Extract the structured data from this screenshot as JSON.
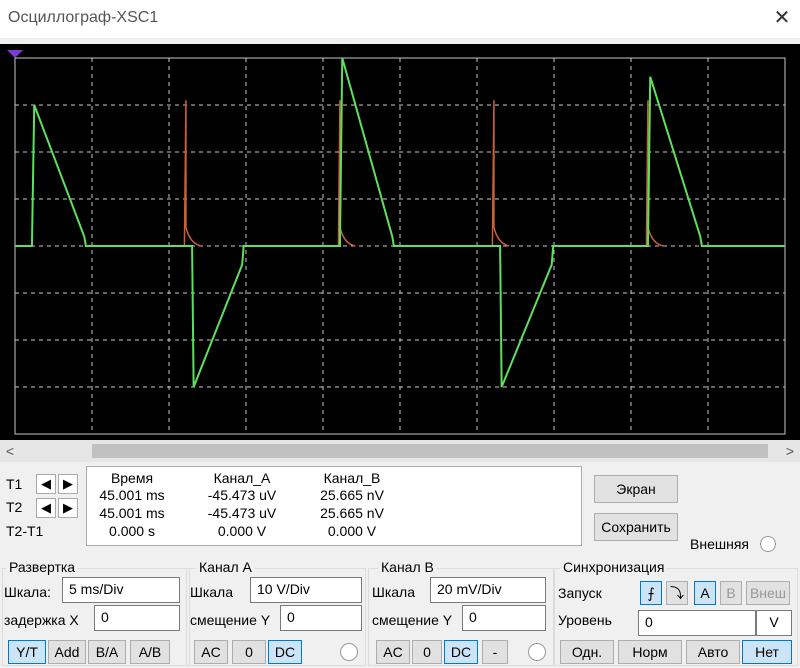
{
  "window": {
    "title": "Осциллограф-XSC1",
    "close": "✕"
  },
  "scrollbar": {
    "left": "<",
    "right": ">"
  },
  "cursors": {
    "t1_label": "T1",
    "t2_label": "T2",
    "dt_label": "T2-T1",
    "left_arrow": "◀",
    "right_arrow": "▶",
    "headers": {
      "time": "Время",
      "a": "Канал_A",
      "b": "Канал_B"
    },
    "rows": [
      {
        "time": "45.001 ms",
        "a": "-45.473 uV",
        "b": "25.665 nV"
      },
      {
        "time": "45.001 ms",
        "a": "-45.473 uV",
        "b": "25.665 nV"
      },
      {
        "time": "0.000 s",
        "a": "0.000 V",
        "b": "0.000 V"
      }
    ]
  },
  "buttons": {
    "screen": "Экран",
    "save": "Сохранить",
    "external": "Внешняя"
  },
  "timebase": {
    "title": "Развертка",
    "scale_label": "Шкала:",
    "scale_value": "5 ms/Div",
    "delay_label": "задержка X",
    "delay_value": "0",
    "modes": [
      "Y/T",
      "Add",
      "B/A",
      "A/B"
    ]
  },
  "channel_a": {
    "title": "Канал A",
    "scale_label": "Шкала",
    "scale_value": "10  V/Div",
    "offset_label": "смещение Y",
    "offset_value": "0",
    "coupling": [
      "AC",
      "0",
      "DC"
    ]
  },
  "channel_b": {
    "title": "Канал B",
    "scale_label": "Шкала",
    "scale_value": "20 mV/Div",
    "offset_label": "смещение Y",
    "offset_value": "0",
    "coupling": [
      "AC",
      "0",
      "DC",
      "-"
    ]
  },
  "trigger": {
    "title": "Синхронизация",
    "edge_label": "Запуск",
    "edge_rise": "⨍",
    "edge_fall": "⤵",
    "sources": [
      "A",
      "B",
      "Внеш"
    ],
    "level_label": "Уровень",
    "level_value": "0",
    "level_unit": "V",
    "modes": [
      "Одн.",
      "Норм",
      "Авто",
      "Нет"
    ]
  },
  "colors": {
    "screen_bg": "#000000",
    "grid": "#c8c8c8",
    "channel_a": "#5ee05e",
    "channel_b": "#c8603a",
    "marker": "#7c3ad6"
  },
  "traces": {
    "description_units": "divisions (x 0-10, y -4..4)",
    "channel_a": [
      [
        0,
        0
      ],
      [
        0.22,
        0
      ],
      [
        0.25,
        3
      ],
      [
        0.9,
        0.2
      ],
      [
        0.92,
        0
      ],
      [
        2.3,
        0
      ],
      [
        2.32,
        -3
      ],
      [
        2.95,
        -0.4
      ],
      [
        2.97,
        0
      ],
      [
        4.22,
        0
      ],
      [
        4.25,
        4
      ],
      [
        4.9,
        0.2
      ],
      [
        4.92,
        0
      ],
      [
        6.3,
        0
      ],
      [
        6.32,
        -3
      ],
      [
        6.97,
        -0.4
      ],
      [
        6.99,
        0
      ],
      [
        8.22,
        0
      ],
      [
        8.25,
        3.6
      ],
      [
        8.9,
        0.2
      ],
      [
        8.92,
        0
      ],
      [
        10,
        0
      ]
    ],
    "channel_b_spikes": [
      2.22,
      4.22,
      6.22,
      8.22
    ]
  }
}
